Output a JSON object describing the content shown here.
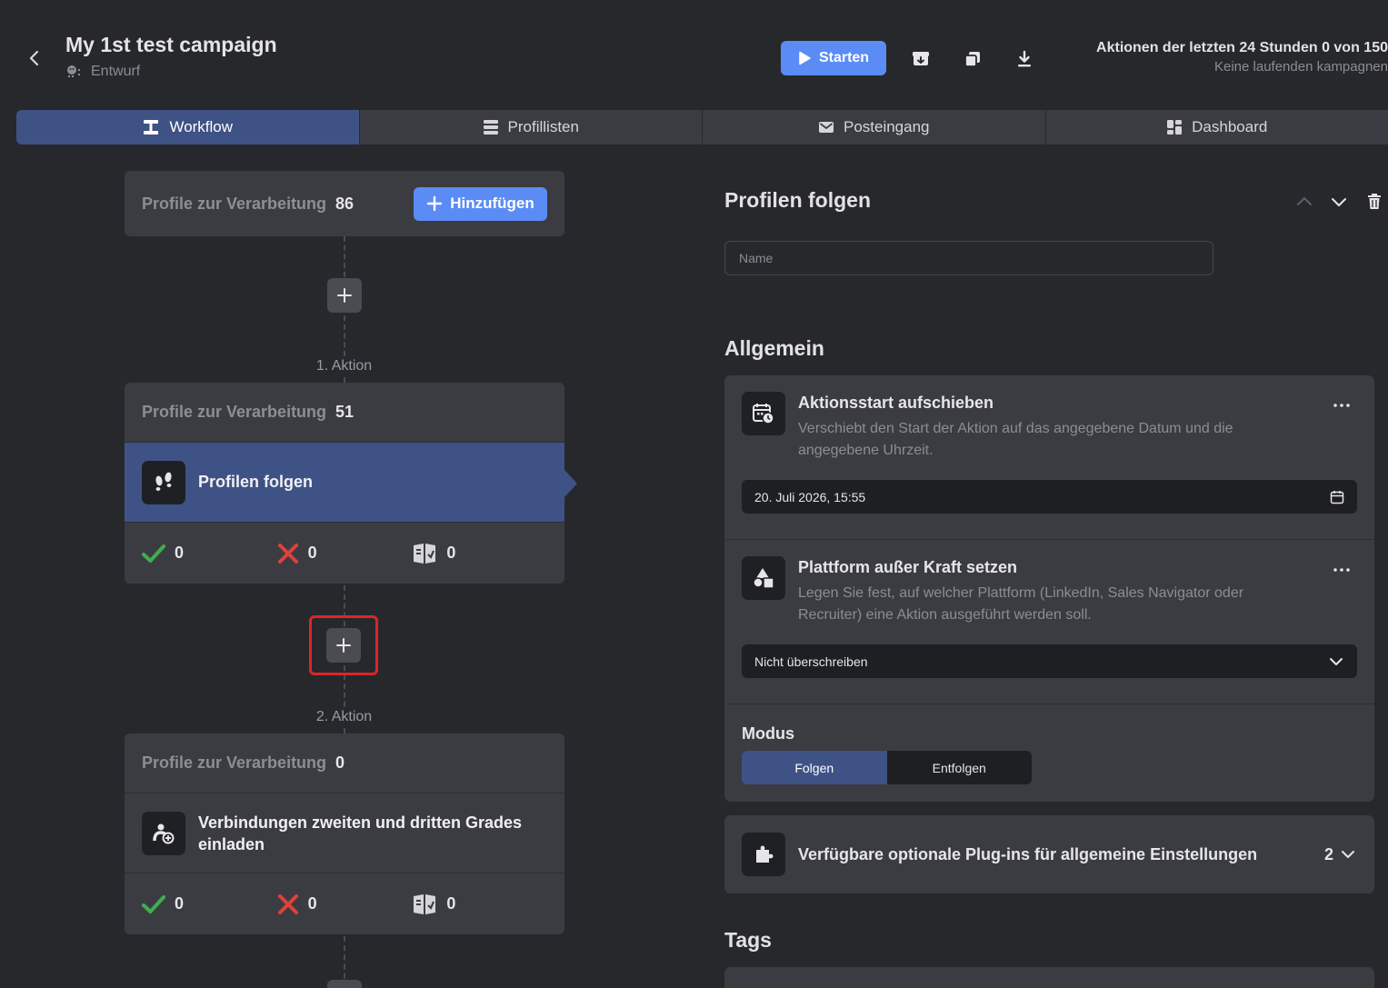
{
  "header": {
    "title": "My 1st test campaign",
    "status": "Entwurf",
    "start_label": "Starten",
    "actions_line1": "Aktionen der letzten 24 Stunden 0 von 150",
    "actions_line2": "Keine laufenden kampagnen"
  },
  "tabs": [
    {
      "label": "Workflow",
      "active": true
    },
    {
      "label": "Profillisten",
      "active": false
    },
    {
      "label": "Posteingang",
      "active": false
    },
    {
      "label": "Dashboard",
      "active": false
    }
  ],
  "workflow": {
    "source": {
      "label": "Profile zur Verarbeitung",
      "count": "86",
      "add_label": "Hinzufügen"
    },
    "steps": [
      {
        "step_label": "1. Aktion",
        "label": "Profile zur Verarbeitung",
        "count": "51",
        "action": "Profilen folgen",
        "success": "0",
        "failed": "0",
        "skipped": "0",
        "selected": true
      },
      {
        "step_label": "2. Aktion",
        "label": "Profile zur Verarbeitung",
        "count": "0",
        "action": "Verbindungen zweiten und dritten Grades einladen",
        "success": "0",
        "failed": "0",
        "skipped": "0",
        "selected": false
      }
    ]
  },
  "panel": {
    "title": "Profilen folgen",
    "name_placeholder": "Name",
    "general_title": "Allgemein",
    "delay": {
      "title": "Aktionsstart aufschieben",
      "desc": "Verschiebt den Start der Aktion auf das angegebene Datum und die angegebene Uhrzeit.",
      "value": "20. Juli 2026, 15:55"
    },
    "platform": {
      "title": "Plattform außer Kraft setzen",
      "desc": "Legen Sie fest, auf welcher Plattform (LinkedIn, Sales Navigator oder Recruiter) eine Aktion ausgeführt werden soll.",
      "value": "Nicht überschreiben"
    },
    "mode": {
      "title": "Modus",
      "options": [
        "Folgen",
        "Entfolgen"
      ],
      "selected": "Folgen"
    },
    "plugins": {
      "title": "Verfügbare optionale Plug-ins für allgemeine Einstellungen",
      "count": "2"
    },
    "tags_title": "Tags"
  },
  "colors": {
    "accent": "#5b8cf5",
    "selected": "#3f5285",
    "success": "#3fae4e",
    "error": "#e0413b",
    "highlight": "#d9262a"
  }
}
